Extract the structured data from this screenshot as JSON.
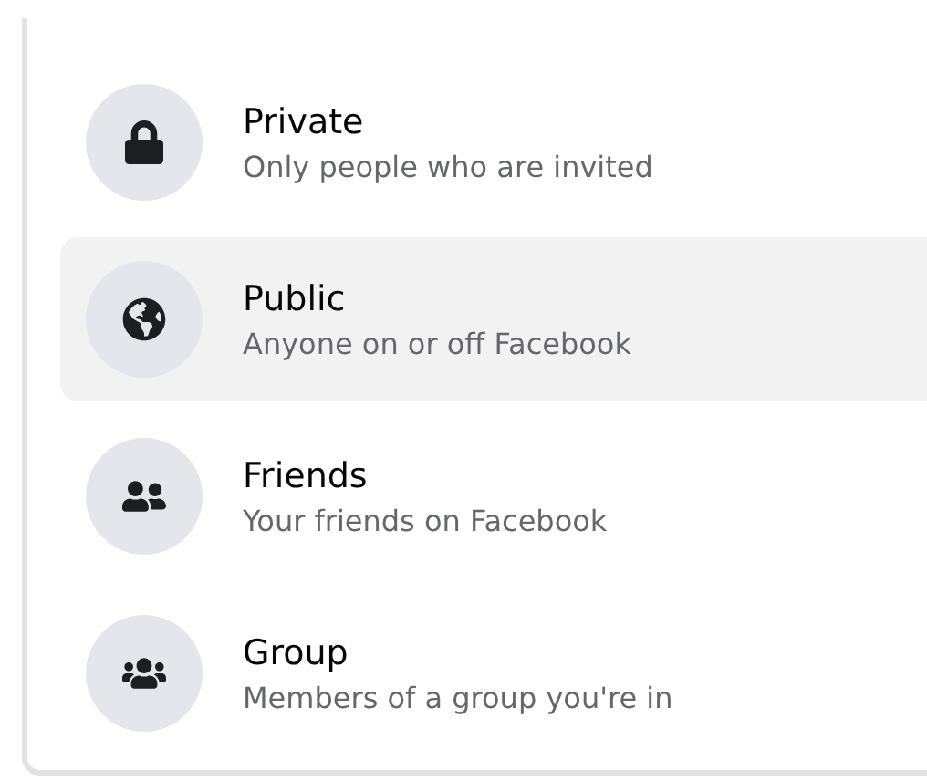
{
  "options": [
    {
      "kind": "lock",
      "title": "Private",
      "description": "Only people who are invited",
      "selected": false
    },
    {
      "kind": "globe",
      "title": "Public",
      "description": "Anyone on or off Facebook",
      "selected": true
    },
    {
      "kind": "friends",
      "title": "Friends",
      "description": "Your friends on Facebook",
      "selected": false
    },
    {
      "kind": "group",
      "title": "Group",
      "description": "Members of a group you're in",
      "selected": false
    }
  ]
}
